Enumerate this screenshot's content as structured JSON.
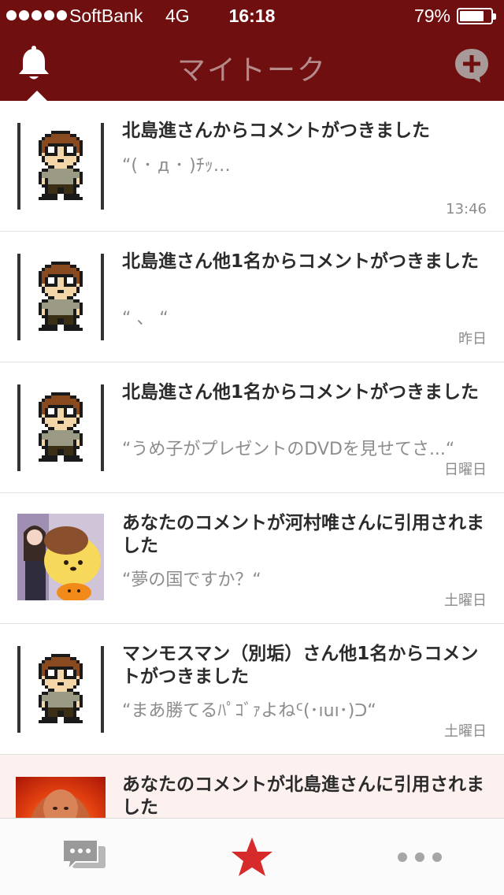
{
  "status_bar": {
    "carrier": "SoftBank",
    "network": "4G",
    "time": "16:18",
    "battery": "79%",
    "battery_level": 0.79
  },
  "nav": {
    "title": "マイトーク",
    "left_icon": "bell-icon",
    "right_icon": "add-comment-icon"
  },
  "notifications": [
    {
      "title": "北島進さんからコメントがつきました",
      "preview": "“( ･ д ･ )ﾁｯ…",
      "time": "13:46",
      "avatar": "pixel-avatar"
    },
    {
      "title": "北島進さん他1名からコメントがつきました",
      "preview": "“ 、 “",
      "time": "昨日",
      "avatar": "pixel-avatar"
    },
    {
      "title": "北島進さん他1名からコメントがつきました",
      "preview": "“うめ子がプレゼントのDVDを見せてさ...“",
      "time": "日曜日",
      "avatar": "pixel-avatar"
    },
    {
      "title": "あなたのコメントが河村唯さんに引用されました",
      "preview": "“夢の国ですか？“",
      "time": "土曜日",
      "avatar": "photo-avatar"
    },
    {
      "title": "マンモスマン（別垢）さん他1名からコメントがつきました",
      "preview": "“まあ勝てるﾊﾟｺﾞｧよねᑦ(･ıuı･)ᑐ“",
      "time": "土曜日",
      "avatar": "pixel-avatar"
    },
    {
      "title": "あなたのコメントが北島進さんに引用されました",
      "preview": "",
      "time": "",
      "avatar": "photo-avatar"
    }
  ],
  "tab_bar": {
    "tabs": [
      {
        "icon": "chat-bubbles-icon",
        "active": false
      },
      {
        "icon": "star-icon",
        "active": true
      },
      {
        "icon": "more-icon",
        "active": false
      }
    ]
  },
  "colors": {
    "header": "#6f0f0f",
    "accent_red": "#d72b2b",
    "title_text": "#2b2b2b",
    "secondary_text": "#8c8c8c"
  }
}
